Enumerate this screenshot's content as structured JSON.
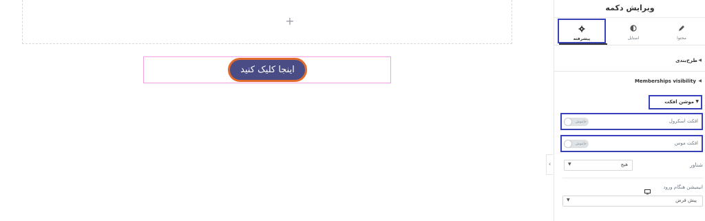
{
  "canvas": {
    "add_icon": "plus-icon",
    "button_text": "اینجا کلیک کنید"
  },
  "colors": {
    "button_bg": "#4a4c86",
    "button_border": "#e06b2c",
    "highlight_box": "#3741b9",
    "widget_outline": "#f0a1e6"
  },
  "panel": {
    "title": "ویرایش دکمه",
    "tabs": [
      {
        "label": "محتوا",
        "icon": "pencil-icon"
      },
      {
        "label": "استایل",
        "icon": "contrast-icon"
      },
      {
        "label": "پیشرفته",
        "icon": "gear-icon"
      }
    ],
    "sections": {
      "layout": "طرح‌بندی",
      "memberships": "Memberships visibility",
      "motion": "موشن افکت"
    },
    "controls": {
      "scroll_effect": "افکت اسکرول",
      "mouse_effect": "افکت موس",
      "toggle_off": "خاموش",
      "float_label": "شناور",
      "float_value": "هیچ",
      "entrance_label": "انیمیشن هنگام ورود",
      "entrance_value": "پیش فرض"
    }
  }
}
